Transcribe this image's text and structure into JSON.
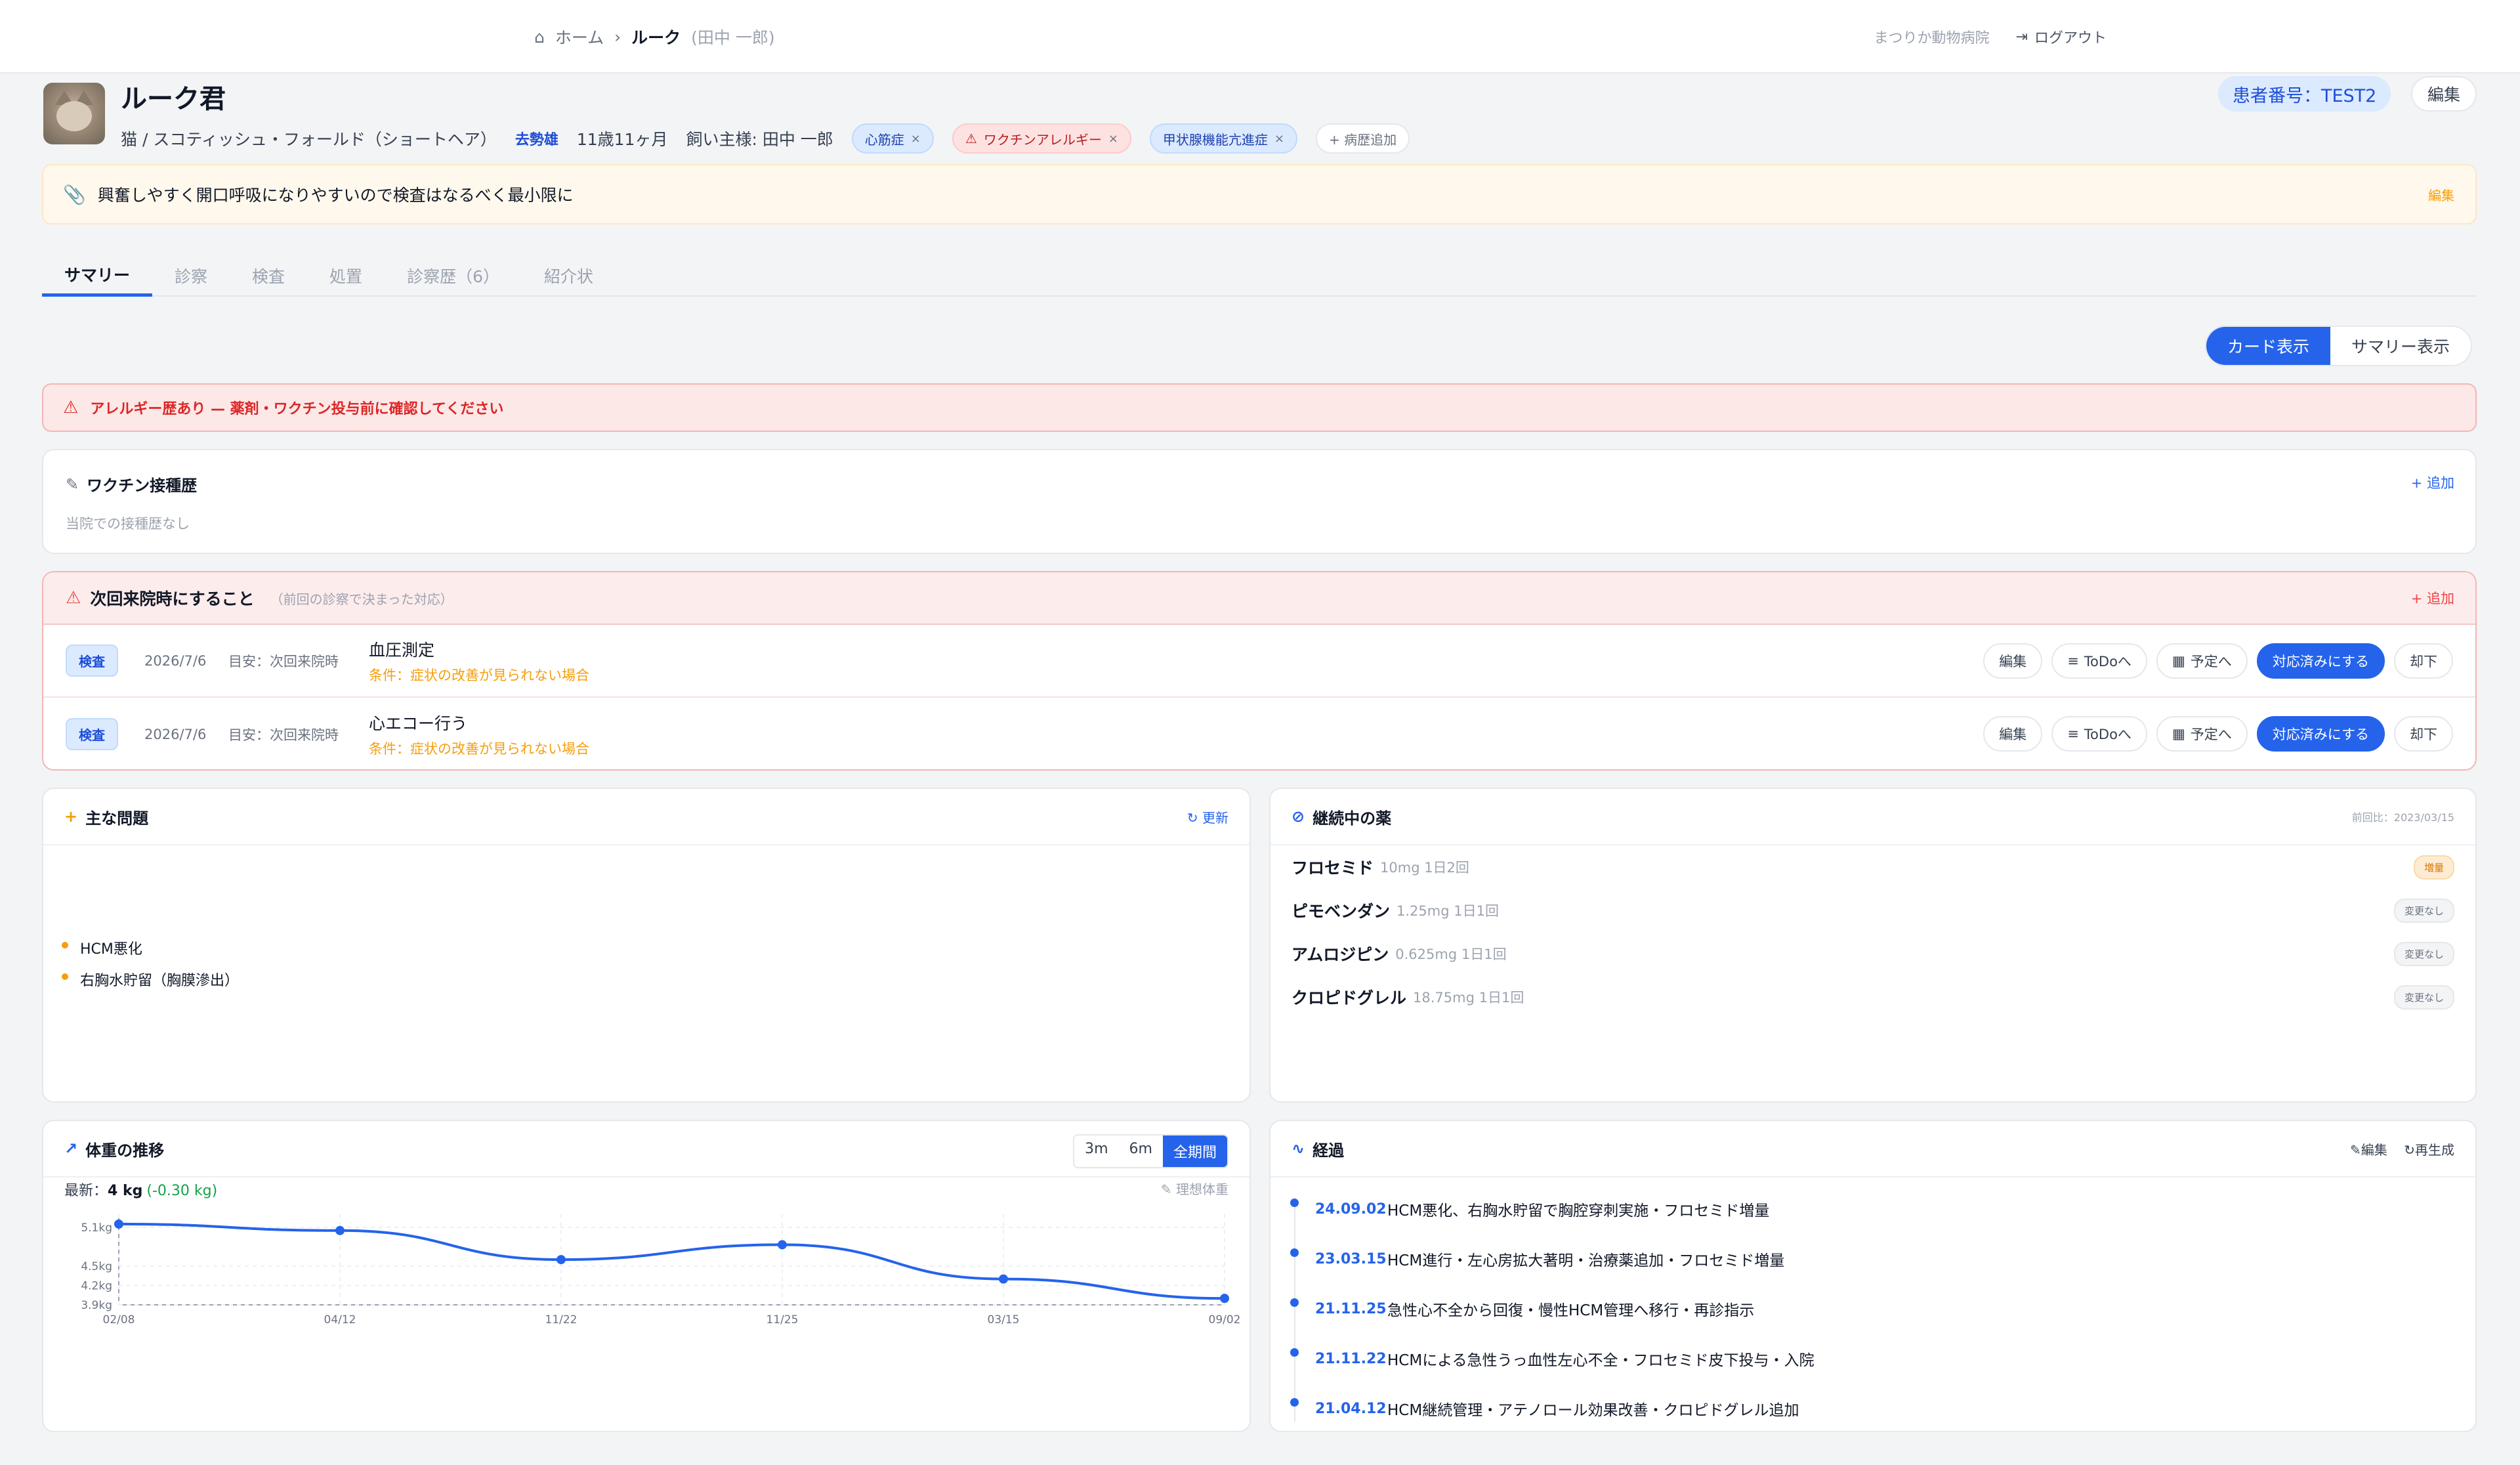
{
  "topbar": {
    "home": "ホーム",
    "current": "ルーク",
    "owner": "(田中 一郎)",
    "clinic": "まつりか動物病院",
    "logout": "ログアウト"
  },
  "patient": {
    "name": "ルーク君",
    "species": "猫 / スコティッシュ・フォールド（ショートヘア）",
    "sex": "去勢雄",
    "age": "11歳11ヶ月",
    "owner": "飼い主様: 田中 一郎",
    "conditions": [
      "心筋症",
      "ワクチンアレルギー",
      "甲状腺機能亢進症"
    ],
    "add_history": "+ 病歴追加",
    "id_label": "患者番号：TEST2",
    "edit": "編集"
  },
  "note": {
    "text": "興奮しやすく開口呼吸になりやすいので検査はなるべく最小限に",
    "edit": "編集"
  },
  "tabs": [
    "サマリー",
    "診察",
    "検査",
    "処置",
    "診察歴（6）",
    "紹介状"
  ],
  "view": {
    "card": "カード表示",
    "summary": "サマリー表示"
  },
  "alert": "アレルギー歴あり — 薬剤・ワクチン投与前に確認してください",
  "vaccine": {
    "title": "ワクチン接種歴",
    "add": "+ 追加",
    "empty": "当院での接種歴なし"
  },
  "todo": {
    "title": "次回来院時にすること",
    "subtitle": "（前回の診察で決まった対応）",
    "add": "+ 追加",
    "items": [
      {
        "tag": "検査",
        "date": "2026/7/6",
        "meta": "目安：次回来院時",
        "title": "血圧測定",
        "cond": "条件：症状の改善が見られない場合"
      },
      {
        "tag": "検査",
        "date": "2026/7/6",
        "meta": "目安：次回来院時",
        "title": "心エコー行う",
        "cond": "条件：症状の改善が見られない場合"
      }
    ],
    "actions": {
      "edit": "編集",
      "todo": "ToDoへ",
      "schedule": "予定へ",
      "done": "対応済みにする",
      "reject": "却下"
    }
  },
  "problems": {
    "title": "主な問題",
    "refresh": "更新",
    "items": [
      "HCM悪化",
      "右胸水貯留（胸膜滲出）"
    ]
  },
  "meds": {
    "title": "継続中の薬",
    "compare": "前回比：2023/03/15",
    "items": [
      {
        "name": "フロセミド",
        "dose": "10mg 1日2回",
        "status": "増量",
        "up": true
      },
      {
        "name": "ピモベンダン",
        "dose": "1.25mg 1日1回",
        "status": "変更なし",
        "up": false
      },
      {
        "name": "アムロジピン",
        "dose": "0.625mg 1日1回",
        "status": "変更なし",
        "up": false
      },
      {
        "name": "クロピドグレル",
        "dose": "18.75mg 1日1回",
        "status": "変更なし",
        "up": false
      }
    ]
  },
  "weight": {
    "title": "体重の推移",
    "ranges": [
      "3m",
      "6m",
      "全期間"
    ],
    "latest_label": "最新：",
    "latest_value": "4 kg",
    "delta": "(-0.30 kg)",
    "ideal": "理想体重"
  },
  "chart_data": {
    "type": "line",
    "categories": [
      "02/08",
      "04/12",
      "11/22",
      "11/25",
      "03/15",
      "09/02"
    ],
    "series": [
      {
        "values": [
          5.15,
          5.05,
          4.6,
          4.83,
          4.3,
          4.0
        ]
      }
    ],
    "yticks": [
      "5.1kg",
      "4.5kg",
      "4.2kg",
      "3.9kg"
    ],
    "ylim": [
      3.9,
      5.2
    ],
    "color": "#2563eb"
  },
  "history": {
    "title": "経過",
    "edit": "編集",
    "regen": "再生成",
    "items": [
      {
        "date": "24.09.02",
        "text": "HCM悪化、右胸水貯留で胸腔穿刺実施・フロセミド増量"
      },
      {
        "date": "23.03.15",
        "text": "HCM進行・左心房拡大著明・治療薬追加・フロセミド増量"
      },
      {
        "date": "21.11.25",
        "text": "急性心不全から回復・慢性HCM管理へ移行・再診指示"
      },
      {
        "date": "21.11.22",
        "text": "HCMによる急性うっ血性左心不全・フロセミド皮下投与・入院"
      },
      {
        "date": "21.04.12",
        "text": "HCM継続管理・アテノロール効果改善・クロピドグレル追加"
      }
    ]
  }
}
